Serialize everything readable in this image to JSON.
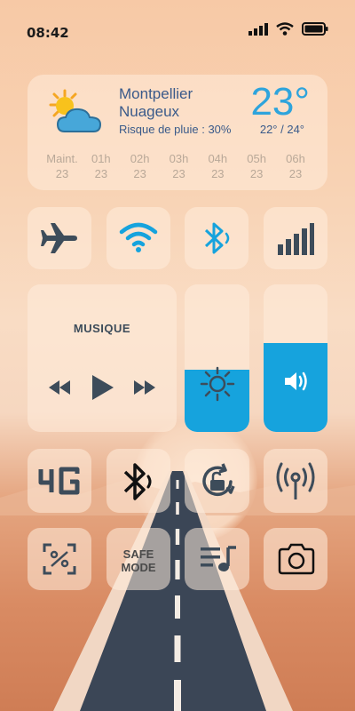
{
  "status_bar": {
    "time": "08:42",
    "icons": [
      "signal-icon",
      "wifi-icon",
      "battery-icon"
    ]
  },
  "weather": {
    "city": "Montpellier",
    "condition": "Nuageux",
    "rain": "Risque de pluie : 30%",
    "temperature": "23°",
    "range": "22° / 24°",
    "icon": "partly-cloudy-icon",
    "forecast": [
      {
        "hour": "Maint.",
        "temp": "23"
      },
      {
        "hour": "01h",
        "temp": "23"
      },
      {
        "hour": "02h",
        "temp": "23"
      },
      {
        "hour": "03h",
        "temp": "23"
      },
      {
        "hour": "04h",
        "temp": "23"
      },
      {
        "hour": "05h",
        "temp": "23"
      },
      {
        "hour": "06h",
        "temp": "23"
      }
    ]
  },
  "toggles": [
    "airplane-icon",
    "wifi-icon",
    "bluetooth-icon",
    "cellular-icon"
  ],
  "music": {
    "title": "MUSIQUE",
    "controls": [
      "previous-icon",
      "play-icon",
      "next-icon"
    ]
  },
  "sliders": {
    "brightness_level": 0.42,
    "volume_level": 0.6
  },
  "row3": [
    "4g-icon",
    "bluetooth-icon",
    "rotation-lock-icon",
    "hotspot-icon"
  ],
  "row4": {
    "safe_mode_line1": "SAFE",
    "safe_mode_line2": "MODE",
    "icons": [
      "screenshot-icon",
      "safe-mode-button",
      "playlist-icon",
      "camera-icon"
    ]
  },
  "colors": {
    "accent": "#16a3dd",
    "icon_dark": "#3d4c5a"
  }
}
